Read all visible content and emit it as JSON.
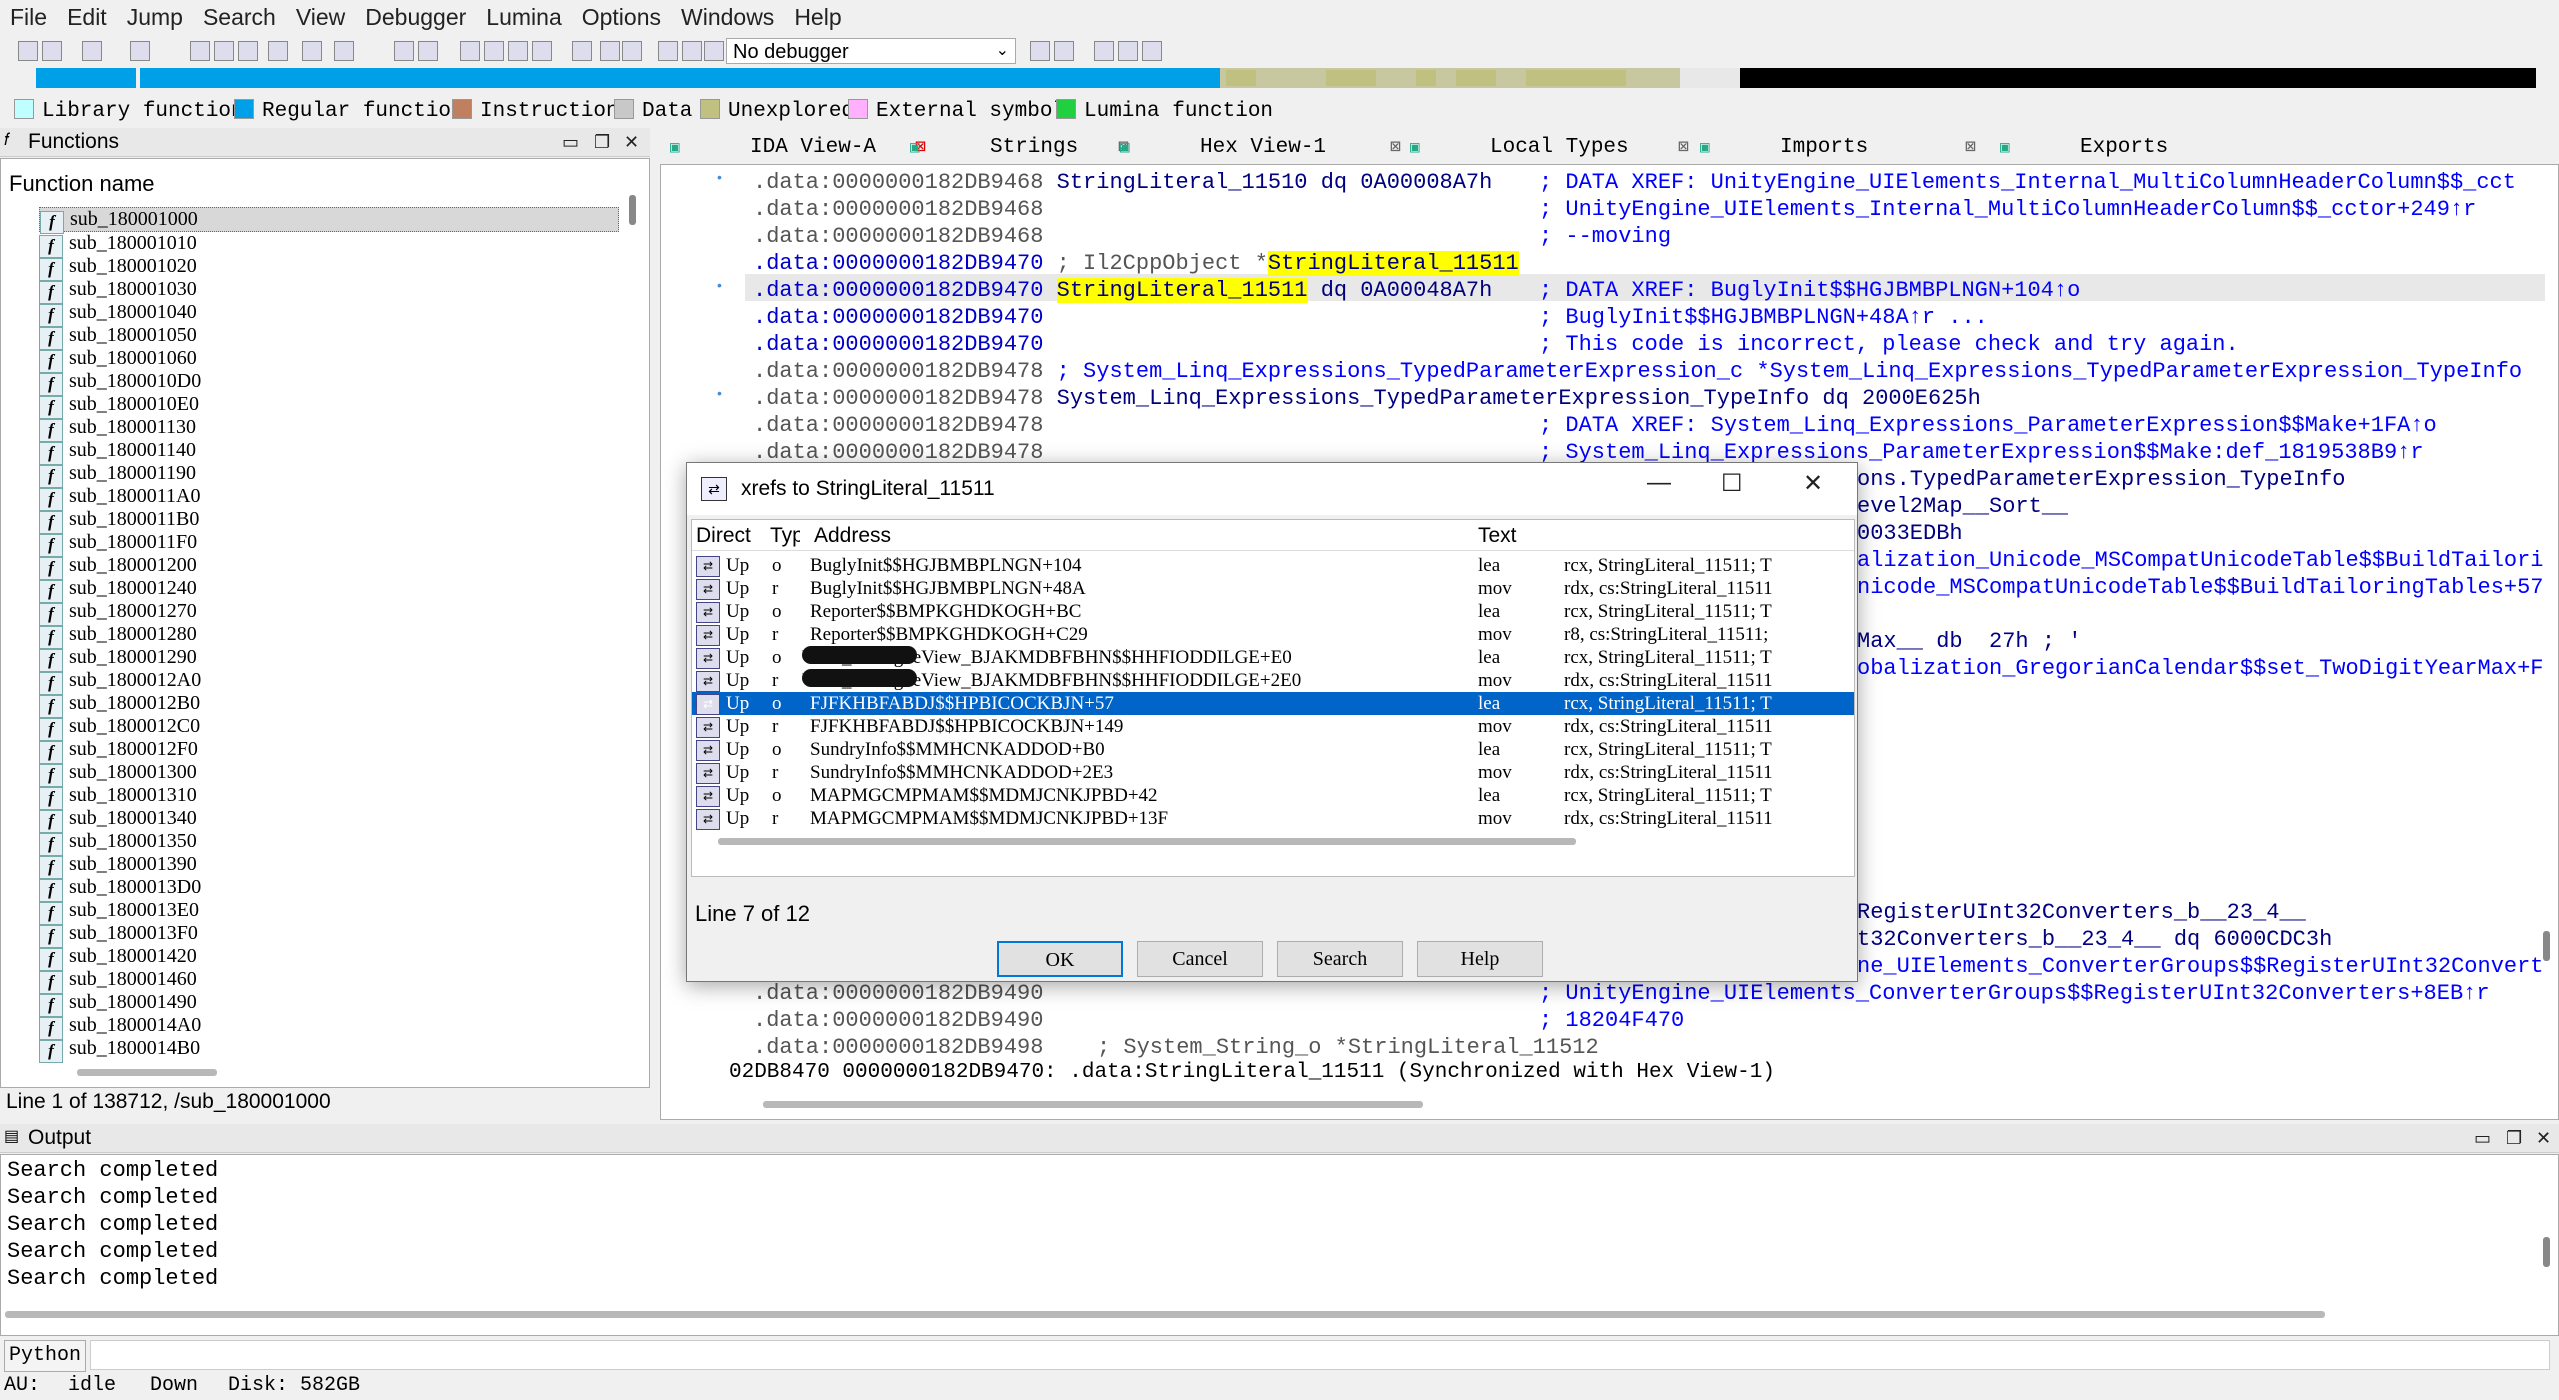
{
  "menu": [
    "File",
    "Edit",
    "Jump",
    "Search",
    "View",
    "Debugger",
    "Lumina",
    "Options",
    "Windows",
    "Help"
  ],
  "toolbar": {
    "debugger_value": "No debugger"
  },
  "legend": [
    {
      "label": "Library function",
      "color": "#c0ffff"
    },
    {
      "label": "Regular function",
      "color": "#00a0e8"
    },
    {
      "label": "Instruction",
      "color": "#c08060"
    },
    {
      "label": "Data",
      "color": "#c8c8c8"
    },
    {
      "label": "Unexplored",
      "color": "#c0c080"
    },
    {
      "label": "External symbol",
      "color": "#ffb0ff"
    },
    {
      "label": "Lumina function",
      "color": "#20d040"
    }
  ],
  "functions_panel": {
    "title": "Functions",
    "column": "Function name",
    "items": [
      "sub_180001000",
      "sub_180001010",
      "sub_180001020",
      "sub_180001030",
      "sub_180001040",
      "sub_180001050",
      "sub_180001060",
      "sub_1800010D0",
      "sub_1800010E0",
      "sub_180001130",
      "sub_180001140",
      "sub_180001190",
      "sub_1800011A0",
      "sub_1800011B0",
      "sub_1800011F0",
      "sub_180001200",
      "sub_180001240",
      "sub_180001270",
      "sub_180001280",
      "sub_180001290",
      "sub_1800012A0",
      "sub_1800012B0",
      "sub_1800012C0",
      "sub_1800012F0",
      "sub_180001300",
      "sub_180001310",
      "sub_180001340",
      "sub_180001350",
      "sub_180001390",
      "sub_1800013D0",
      "sub_1800013E0",
      "sub_1800013F0",
      "sub_180001420",
      "sub_180001460",
      "sub_180001490",
      "sub_1800014A0",
      "sub_1800014B0"
    ],
    "status": "Line 1 of 138712, /sub_180001000"
  },
  "tabs": [
    {
      "label": "IDA View-A"
    },
    {
      "label": "Strings"
    },
    {
      "label": "Hex View-1"
    },
    {
      "label": "Local Types"
    },
    {
      "label": "Imports"
    },
    {
      "label": "Exports"
    }
  ],
  "ida_lines": [
    {
      "seg": ".data:0000000182DB9468",
      "code": "StringLiteral_11510 dq 0A00008A7h",
      "cm": "; DATA XREF: UnityEngine_UIElements_Internal_MultiColumnHeaderColumn$$_cct"
    },
    {
      "seg": ".data:0000000182DB9468",
      "code": "",
      "cm": "; UnityEngine_UIElements_Internal_MultiColumnHeaderColumn$$_cctor+249↑r"
    },
    {
      "seg": ".data:0000000182DB9468",
      "code": "",
      "cm": "; --moving"
    },
    {
      "seg": ".data:0000000182DB9470",
      "code": "; Il2CppObject *",
      "hl": "StringLiteral_11511",
      "cm": ""
    },
    {
      "seg": ".data:0000000182DB9470",
      "code": "",
      "hl": "StringLiteral_11511",
      "code2": " dq 0A00048A7h",
      "cm": "; DATA XREF: BuglyInit$$HGJBMBPLNGN+104↑o"
    },
    {
      "seg": ".data:0000000182DB9470",
      "code": "",
      "cm": "; BuglyInit$$HGJBMBPLNGN+48A↑r ..."
    },
    {
      "seg": ".data:0000000182DB9470",
      "code": "",
      "cm": "; This code is incorrect, please check and try again."
    },
    {
      "seg": ".data:0000000182DB9478",
      "code": "; System_Linq_Expressions_TypedParameterExpression_c *System_Linq_Expressions_TypedParameterExpression_TypeInfo",
      "cm": ""
    },
    {
      "seg": ".data:0000000182DB9478",
      "code": "System_Linq_Expressions_TypedParameterExpression_TypeInfo dq 2000E625h",
      "cm": ""
    },
    {
      "seg": ".data:0000000182DB9478",
      "code": "",
      "cm": "; DATA XREF: System_Linq_Expressions_ParameterExpression$$Make+1FA↑o"
    },
    {
      "seg": ".data:0000000182DB9478",
      "code": "",
      "cm": "; System_Linq_Expressions_ParameterExpression$$Make:def_1819538B9↑r"
    }
  ],
  "ida_right_fragments": [
    "ons.TypedParameterExpression_TypeInfo",
    "evel2Map__Sort__",
    "0033EDBh",
    "alization_Unicode_MSCompatUnicodeTable$$BuildTailori",
    "nicode_MSCompatUnicodeTable$$BuildTailoringTables+57",
    "Max__ db  27h ; '",
    "obalization_GregorianCalendar$$set_TwoDigitYearMax+F",
    "RegisterUInt32Converters_b__23_4__",
    "t32Converters_b__23_4__ dq 6000CDC3h",
    "ne_UIElements_ConverterGroups$$RegisterUInt32Convert"
  ],
  "ida_bottom_lines": [
    {
      "seg": ".data:0000000182DB9490",
      "cm": "; UnityEngine_UIElements_ConverterGroups$$RegisterUInt32Converters+8EB↑r"
    },
    {
      "seg": ".data:0000000182DB9490",
      "cm": "; 18204F470"
    },
    {
      "seg": ".data:0000000182DB9498",
      "cm": "; System_String_o *StringLiteral_11512"
    }
  ],
  "sync_text": "02DB8470 0000000182DB9470: .data:StringLiteral_11511 (Synchronized with Hex View-1)",
  "dialog": {
    "title": "xrefs to StringLiteral_11511",
    "columns": [
      "Direct",
      "Typ",
      "Address",
      "Text"
    ],
    "rows": [
      {
        "dir": "Up",
        "typ": "o",
        "addr": "BuglyInit$$HGJBMBPLNGN+104",
        "op": "lea",
        "text": "rcx, StringLiteral_11511; T"
      },
      {
        "dir": "Up",
        "typ": "r",
        "addr": "BuglyInit$$HGJBMBPLNGN+48A",
        "op": "mov",
        "text": "rdx, cs:StringLiteral_11511"
      },
      {
        "dir": "Up",
        "typ": "o",
        "addr": "Reporter$$BMPKGHDKOGH+BC",
        "op": "lea",
        "text": "rcx, StringLiteral_11511; T"
      },
      {
        "dir": "Up",
        "typ": "r",
        "addr": "Reporter$$BMPKGHDKOGH+C29",
        "op": "mov",
        "text": "r8, cs:StringLiteral_11511;"
      },
      {
        "dir": "Up",
        "typ": "o",
        "addr": "View_DialogueView_BJAKMDBFBHN$$HHFIODDILGE+E0",
        "redact": true,
        "op": "lea",
        "text": "rcx, StringLiteral_11511; T"
      },
      {
        "dir": "Up",
        "typ": "r",
        "addr": "View_DialogueView_BJAKMDBFBHN$$HHFIODDILGE+2E0",
        "redact": true,
        "op": "mov",
        "text": "rdx, cs:StringLiteral_11511"
      },
      {
        "dir": "Up",
        "typ": "o",
        "addr": "FJFKHBFABDJ$$HPBICOCKBJN+57",
        "op": "lea",
        "text": "rcx, StringLiteral_11511; T",
        "selected": true
      },
      {
        "dir": "Up",
        "typ": "r",
        "addr": "FJFKHBFABDJ$$HPBICOCKBJN+149",
        "op": "mov",
        "text": "rdx, cs:StringLiteral_11511"
      },
      {
        "dir": "Up",
        "typ": "o",
        "addr": "SundryInfo$$MMHCNKADDOD+B0",
        "op": "lea",
        "text": "rcx, StringLiteral_11511; T"
      },
      {
        "dir": "Up",
        "typ": "r",
        "addr": "SundryInfo$$MMHCNKADDOD+2E3",
        "op": "mov",
        "text": "rdx, cs:StringLiteral_11511"
      },
      {
        "dir": "Up",
        "typ": "o",
        "addr": "MAPMGCMPMAM$$MDMJCNKJPBD+42",
        "op": "lea",
        "text": "rcx, StringLiteral_11511; T"
      },
      {
        "dir": "Up",
        "typ": "r",
        "addr": "MAPMGCMPMAM$$MDMJCNKJPBD+13F",
        "op": "mov",
        "text": "rdx, cs:StringLiteral_11511"
      }
    ],
    "status": "Line 7 of 12",
    "buttons": {
      "ok": "OK",
      "cancel": "Cancel",
      "search": "Search",
      "help": "Help"
    }
  },
  "output": {
    "title": "Output",
    "lines": [
      "Search completed",
      "Search completed",
      "Search completed",
      "Search completed",
      "Search completed"
    ]
  },
  "python_label": "Python",
  "status": {
    "au": "AU:",
    "au_val": "idle",
    "dir": "Down",
    "disk": "Disk: 582GB"
  }
}
